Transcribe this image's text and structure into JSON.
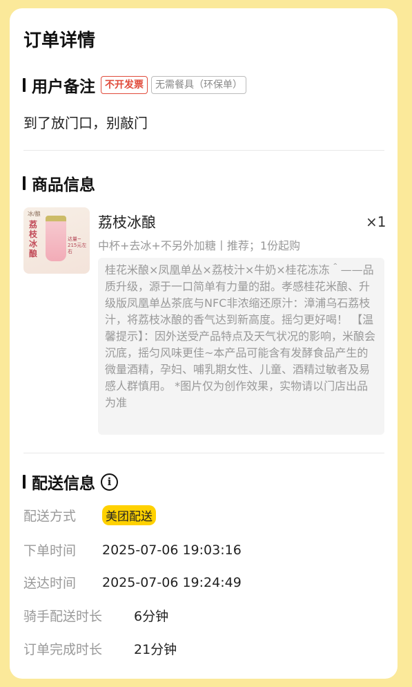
{
  "title": "订单详情",
  "remark_section": {
    "title": "用户备注",
    "tags": [
      "不开发票",
      "无需餐具（环保单）"
    ],
    "remark": "到了放门口，别敲门"
  },
  "product_section": {
    "title": "商品信息",
    "product": {
      "image_brand": "冰/酿",
      "image_name": "荔枝冰酿",
      "image_badge": "达量~ 215元左右",
      "name": "荔枝冰酿",
      "quantity": "×1",
      "spec": "中杯+去冰+不另外加糖丨推荐；1份起购",
      "description": "桂花米酿×凤凰单丛×荔枝汁×牛奶×桂花冻冻＾——品质升级，源于一口简单有力量的甜。孝感桂花米酿、升级版凤凰单丛茶底与NFC非浓缩还原汁：漳浦乌石荔枝汁，将荔枝冰酿的香气达到新高度。摇匀更好喝！ 【温馨提示】：因外送受产品特点及天气状况的影响，米酿会沉底，摇匀风味更佳~本产品可能含有发酵食品产生的微量酒精，孕妇、哺乳期女性、儿童、酒精过敏者及易感人群慎用。 *图片仅为创作效果，实物请以门店出品为准"
    }
  },
  "delivery_section": {
    "title": "配送信息",
    "info_icon": "info-icon",
    "rows": [
      {
        "label": "配送方式",
        "value": "美团配送"
      },
      {
        "label": "下单时间",
        "value": "2025-07-06 19:03:16"
      },
      {
        "label": "送达时间",
        "value": "2025-07-06 19:24:49"
      },
      {
        "label": "骑手配送时长",
        "value": "6分钟"
      },
      {
        "label": "订单完成时长",
        "value": "21分钟"
      }
    ]
  },
  "colors": {
    "background": "#fbe99a",
    "tag_red": "#e04a3a",
    "meituan_yellow": "#ffd100"
  }
}
